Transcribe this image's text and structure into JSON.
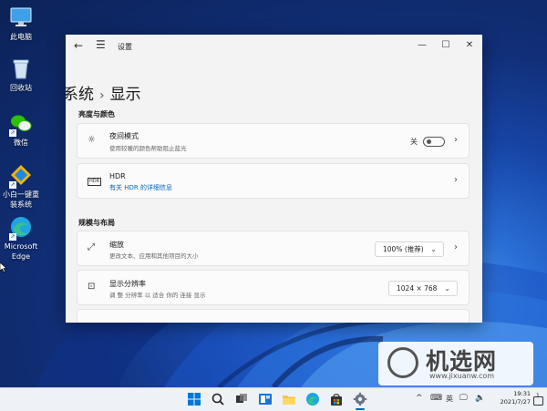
{
  "desktop": {
    "icons": [
      {
        "label": "此电脑",
        "icon": "computer-icon"
      },
      {
        "label": "回收站",
        "icon": "recycle-bin-icon"
      },
      {
        "label": "微信",
        "icon": "wechat-icon"
      },
      {
        "label": "小白一键重装系统",
        "icon": "installer-icon"
      },
      {
        "label": "Microsoft Edge",
        "icon": "edge-icon"
      }
    ]
  },
  "window": {
    "title": "设置",
    "controls": {
      "minimize": "—",
      "maximize": "☐",
      "close": "✕"
    },
    "breadcrumb": {
      "parent": "系统",
      "separator": "›",
      "current": "显示"
    },
    "sections": [
      {
        "label": "亮度与颜色",
        "items": [
          {
            "icon": "brightness-icon",
            "title": "夜间模式",
            "subtitle": "使用较暖的颜色帮助阻止蓝光",
            "toggle_label": "关",
            "toggle_on": false
          },
          {
            "icon": "hdr-icon",
            "icon_text": "HDR",
            "title": "HDR",
            "link": "有关 HDR 的详细信息"
          }
        ]
      },
      {
        "label": "规模与布局",
        "items": [
          {
            "icon": "scale-icon",
            "title": "缩放",
            "subtitle": "更改文本、应用和其他项目的大小",
            "value": "100% (推荐)"
          },
          {
            "icon": "resolution-icon",
            "title": "显示分辨率",
            "subtitle": "调 整 分辨率 以 适合 你的 连接 显示",
            "value": "1024 × 768"
          }
        ]
      }
    ]
  },
  "watermark": {
    "text": "机选网",
    "url": "www.jixuanw.com"
  },
  "taskbar": {
    "icons": [
      "windows-start-icon",
      "search-icon",
      "task-view-icon",
      "widgets-icon",
      "file-explorer-icon",
      "edge-icon",
      "store-icon",
      "settings-icon"
    ],
    "tray": {
      "chevron": "^",
      "lang": "英",
      "badge": "1"
    },
    "clock": {
      "time": "19:31",
      "date": "2021/7/27"
    }
  },
  "colors": {
    "accent": "#0067c0",
    "window_bg": "#f3f3f3",
    "card_bg": "#fbfbfb",
    "taskbar_bg": "#eef1f6"
  }
}
